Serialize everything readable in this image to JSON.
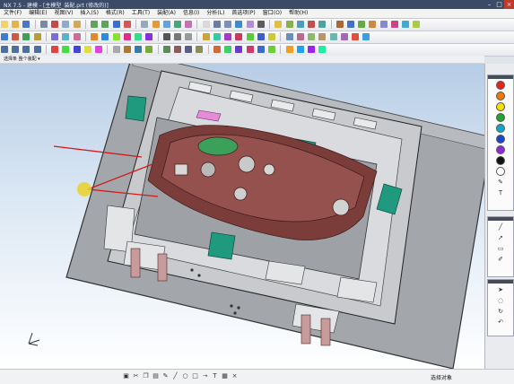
{
  "app": {
    "title": "NX 7.5 - 建模 - [主模型_装配.prt (修改的)]"
  },
  "window_controls": {
    "minimize": "–",
    "maximize": "□",
    "close": "×"
  },
  "menubar": {
    "items": [
      "文件(F)",
      "编辑(E)",
      "视图(V)",
      "插入(S)",
      "格式(R)",
      "工具(T)",
      "装配(A)",
      "信息(I)",
      "分析(L)",
      "首选项(P)",
      "窗口(O)",
      "帮助(H)"
    ]
  },
  "cmdbar": {
    "label": "选择条  整个装配  ▾"
  },
  "status": {
    "text": "选择对象"
  },
  "colors": {
    "palette_swatches": [
      "#e8231b",
      "#f07800",
      "#f0e000",
      "#1fa52f",
      "#12a4c9",
      "#1b46c8",
      "#8a2bd8",
      "#111111",
      "#ffffff"
    ],
    "teal": "#1f9a7f",
    "dash": "#7b3d3a",
    "plate": "#a3a6aa",
    "highlight": "#e4c126"
  },
  "icons": {
    "palette_tools": [
      "pen-icon",
      "text-icon",
      "line-icon",
      "arrow-icon",
      "eraser-icon",
      "brush-icon"
    ],
    "palette_tools2": [
      "select-icon",
      "lasso-icon",
      "rotate-icon"
    ],
    "bottom_tools": [
      "save-icon",
      "cut-icon",
      "copy-icon",
      "paste-icon",
      "pen-icon",
      "circle-icon",
      "square-icon",
      "arrow-icon",
      "line-icon",
      "text-icon",
      "grid-icon",
      "close-icon"
    ]
  }
}
